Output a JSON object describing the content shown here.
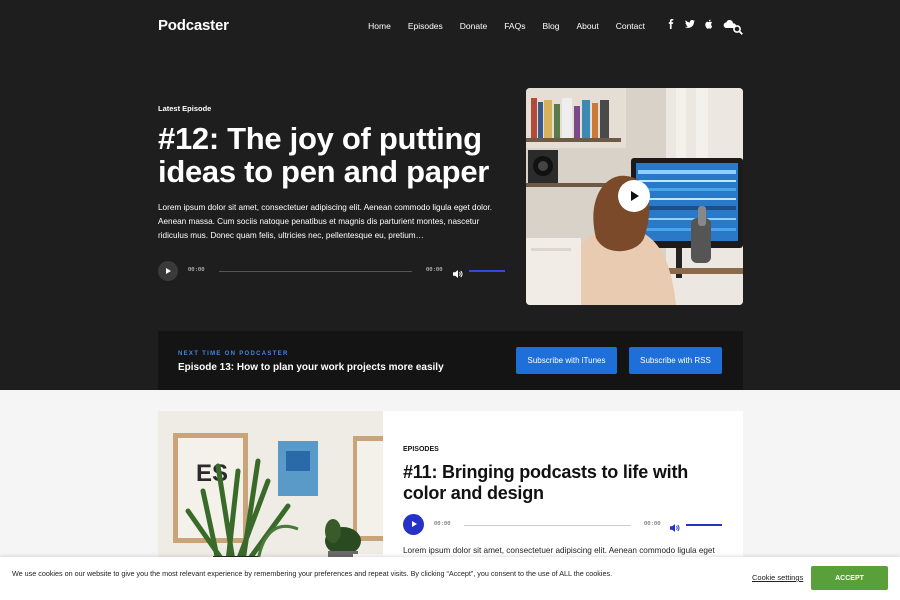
{
  "site": {
    "logo": "Podcaster"
  },
  "nav": {
    "items": [
      "Home",
      "Episodes",
      "Donate",
      "FAQs",
      "Blog",
      "About",
      "Contact"
    ]
  },
  "socials": {
    "facebook": "f",
    "twitter": "t",
    "apple": "a",
    "soundcloud": "s"
  },
  "hero": {
    "label": "Latest Episode",
    "title": "#12: The joy of putting ideas to pen and paper",
    "description": "Lorem ipsum dolor sit amet, consectetuer adipiscing elit. Aenean commodo ligula eget dolor. Aenean massa. Cum sociis natoque penatibus et magnis dis parturient montes, nascetur ridiculus mus. Donec quam felis, ultricies nec, pellentesque eu, pretium…",
    "player": {
      "current": "00:00",
      "duration": "00:00"
    }
  },
  "next": {
    "label": "NEXT TIME ON PODCASTER",
    "title": "Episode 13: How to plan your work projects more easily",
    "buttons": {
      "itunes": "Subscribe with iTunes",
      "rss": "Subscribe with RSS"
    }
  },
  "episode_card": {
    "label": "EPISODES",
    "title": "#11: Bringing podcasts to life with color and design",
    "player": {
      "current": "00:00",
      "duration": "00:00"
    },
    "description": "Lorem ipsum dolor sit amet, consectetuer adipiscing elit. Aenean commodo ligula eget"
  },
  "cookie": {
    "text": "We use cookies on our website to give you the most relevant experience by remembering your preferences and repeat visits. By clicking “Accept”, you consent to the use of ALL the cookies.",
    "settings": "Cookie settings",
    "accept": "ACCEPT"
  },
  "colors": {
    "accent_blue": "#1e6fd9",
    "player_blue": "#2532c8",
    "accept_green": "#5aa03a",
    "dark_bg": "#1e1e1e"
  }
}
